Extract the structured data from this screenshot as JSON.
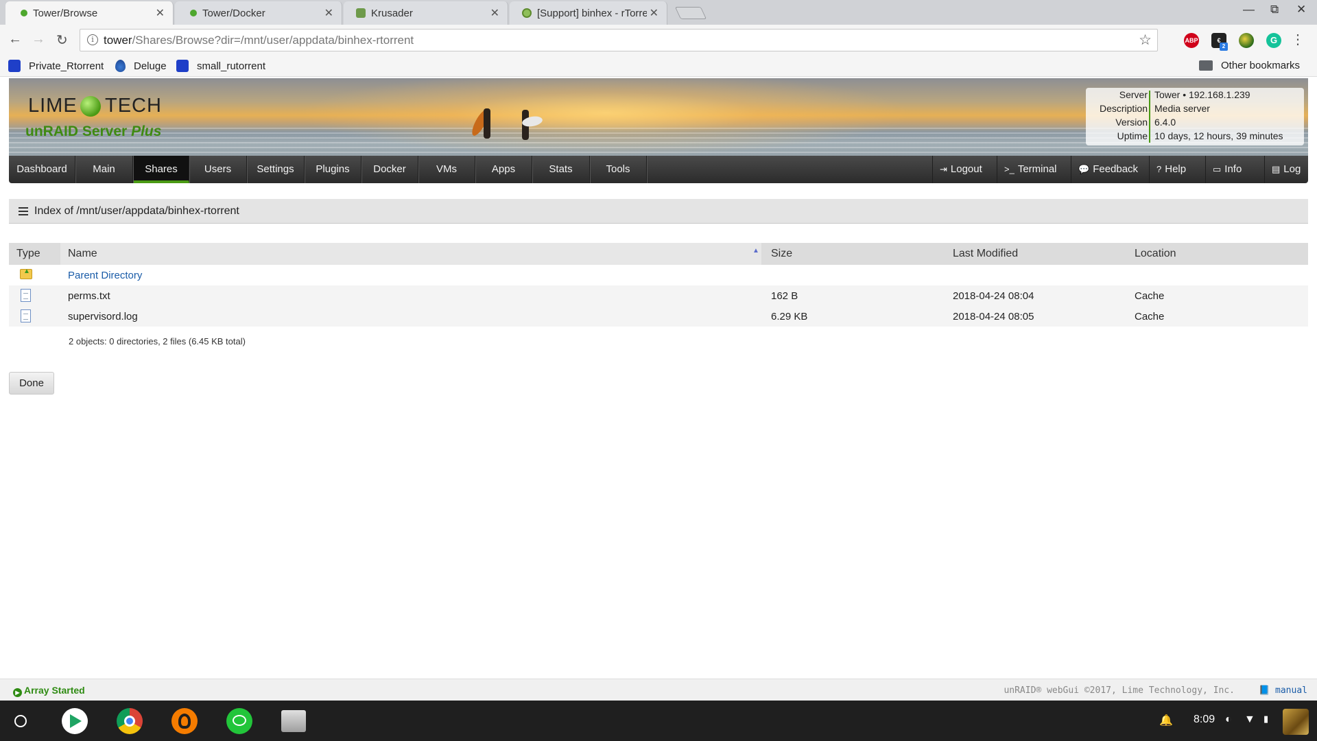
{
  "browser": {
    "tabs": [
      {
        "title": "Tower/Browse",
        "active": true
      },
      {
        "title": "Tower/Docker",
        "active": false
      },
      {
        "title": "Krusader",
        "active": false
      },
      {
        "title": "[Support] binhex - rTorrent",
        "active": false
      }
    ],
    "tab_close": "✕",
    "window_controls": {
      "minimize": "—",
      "maximize": "⧉",
      "close": "✕"
    },
    "url_host": "tower",
    "url_path": "/Shares/Browse?dir=/mnt/user/appdata/binhex-rtorrent",
    "extensions": {
      "abp": "ABP",
      "badge": "2"
    },
    "bookmarks": [
      {
        "label": "Private_Rtorrent"
      },
      {
        "label": "Deluge"
      },
      {
        "label": "small_rutorrent"
      }
    ],
    "other_bookmarks": "Other bookmarks"
  },
  "header": {
    "logo_lime": "LIME",
    "logo_tech": "TECH",
    "logo_sub_prefix": "unRAID Server",
    "logo_sub_edition": "Plus",
    "server_info": {
      "server_label": "Server",
      "server_value": "Tower • 192.168.1.239",
      "description_label": "Description",
      "description_value": "Media server",
      "version_label": "Version",
      "version_value": "6.4.0",
      "uptime_label": "Uptime",
      "uptime_value": "10 days, 12 hours, 39 minutes"
    }
  },
  "nav": {
    "items": [
      "Dashboard",
      "Main",
      "Shares",
      "Users",
      "Settings",
      "Plugins",
      "Docker",
      "VMs",
      "Apps",
      "Stats",
      "Tools"
    ],
    "active": "Shares",
    "right": [
      "Logout",
      "Terminal",
      "Feedback",
      "Help",
      "Info",
      "Log"
    ]
  },
  "page": {
    "title": "Index of /mnt/user/appdata/binhex-rtorrent",
    "columns": {
      "type": "Type",
      "name": "Name",
      "size": "Size",
      "modified": "Last Modified",
      "location": "Location"
    },
    "rows": [
      {
        "name": "Parent Directory",
        "size": "",
        "modified": "",
        "location": ""
      },
      {
        "name": "perms.txt",
        "size": "162 B",
        "modified": "2018-04-24 08:04",
        "location": "Cache"
      },
      {
        "name": "supervisord.log",
        "size": "6.29 KB",
        "modified": "2018-04-24 08:05",
        "location": "Cache"
      }
    ],
    "summary": "2 objects: 0 directories, 2 files (6.45 KB total)",
    "done_label": "Done"
  },
  "footer": {
    "array_status": "Array Started",
    "copyright": "unRAID® webGui ©2017, Lime Technology, Inc.",
    "manual": "manual"
  },
  "shelf": {
    "time": "8:09"
  },
  "colors": {
    "accent_green": "#4a9a14",
    "link_blue": "#1a5ca8",
    "nav_dark": "#2b2b2b"
  }
}
